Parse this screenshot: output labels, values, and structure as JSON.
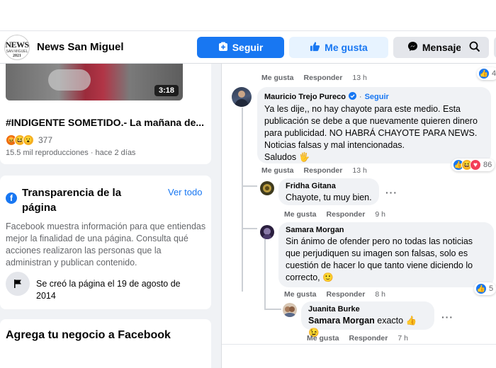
{
  "header": {
    "page_name": "News San Miguel",
    "logo_text": "NEWS",
    "logo_sub": "SAN MIGUEL",
    "logo_year": "2021",
    "follow_label": "Seguir",
    "like_label": "Me gusta",
    "message_label": "Mensaje"
  },
  "left": {
    "video": {
      "duration": "3:18",
      "title": "#INDIGENTE SOMETIDO.- La mañana de...",
      "reaction_count": "377",
      "meta": "15.5 mil reproducciones · hace 2 días"
    },
    "transparency": {
      "title": "Transparencia de la página",
      "link": "Ver todo",
      "description": "Facebook muestra información para que entiendas mejor la finalidad de una página. Consulta qué acciones realizaron las personas que la administran y publican contenido.",
      "created": "Se creó la página el 19 de agosto de 2014"
    },
    "business": {
      "title": "Agrega tu negocio a Facebook"
    }
  },
  "comments": {
    "top_meta": {
      "like": "Me gusta",
      "reply": "Responder",
      "time": "13 h",
      "reactions": "4"
    },
    "c1": {
      "name": "Mauricio Trejo Pureco",
      "follow": "Seguir",
      "text": "Ya les dije,, no hay chayote para este medio. Esta publicación se debe a que nuevamente quieren dinero para publicidad. NO HABRÁ CHAYOTE PARA NEWS. Noticias falsas y mal intencionadas.",
      "text2": "Saludos",
      "like": "Me gusta",
      "reply": "Responder",
      "time": "13 h",
      "reactions": "86"
    },
    "c2": {
      "name": "Fridha Gitana",
      "text": "Chayote, tu muy bien.",
      "like": "Me gusta",
      "reply": "Responder",
      "time": "9 h"
    },
    "c3": {
      "name": "Samara Morgan",
      "text": "Sin ánimo de ofender pero no todas las noticias que perjudiquen su imagen son falsas, solo es cuestión de hacer lo que tanto viene diciendo lo correcto,",
      "like": "Me gusta",
      "reply": "Responder",
      "time": "8 h",
      "reactions": "5"
    },
    "c4": {
      "name": "Juanita Burke",
      "mention": "Samara Morgan",
      "text": "exacto",
      "like": "Me gusta",
      "reply": "Responder",
      "time": "7 h"
    }
  },
  "colors": {
    "brand": "#1877f2",
    "muted": "#65676b",
    "bubble": "#f0f2f5"
  },
  "icons": [
    "plus-box-icon",
    "thumbs-up-icon",
    "messenger-icon",
    "search-icon",
    "flag-icon",
    "verified-badge-icon",
    "ellipsis-icon"
  ]
}
